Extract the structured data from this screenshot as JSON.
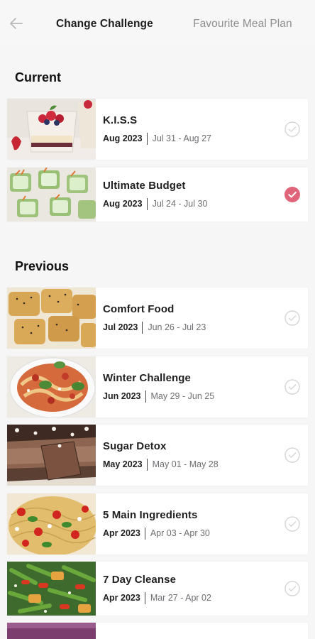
{
  "header": {
    "back_icon": "arrow-left-icon",
    "tabs": [
      {
        "label": "Change Challenge",
        "active": true
      },
      {
        "label": "Favourite Meal Plan",
        "active": false
      }
    ]
  },
  "sections": {
    "current_title": "Current",
    "previous_title": "Previous"
  },
  "current": [
    {
      "title": "K.I.S.S",
      "month": "Aug 2023",
      "range": "Jul 31 - Aug 27",
      "selected": false
    },
    {
      "title": "Ultimate Budget",
      "month": "Aug 2023",
      "range": "Jul 24 - Jul 30",
      "selected": true
    }
  ],
  "previous": [
    {
      "title": "Comfort Food",
      "month": "Jul 2023",
      "range": "Jun 26 - Jul 23",
      "selected": false
    },
    {
      "title": "Winter Challenge",
      "month": "Jun 2023",
      "range": "May 29 - Jun 25",
      "selected": false
    },
    {
      "title": "Sugar Detox",
      "month": "May 2023",
      "range": "May 01 - May 28",
      "selected": false
    },
    {
      "title": "5 Main Ingredients",
      "month": "Apr 2023",
      "range": "Apr 03 - Apr 30",
      "selected": false
    },
    {
      "title": "7 Day Cleanse",
      "month": "Apr 2023",
      "range": "Mar 27 - Apr 02",
      "selected": false
    }
  ],
  "colors": {
    "selected_check": "#e0657a",
    "unselected_check": "#d6d6d8",
    "background": "#f6f6f6"
  }
}
